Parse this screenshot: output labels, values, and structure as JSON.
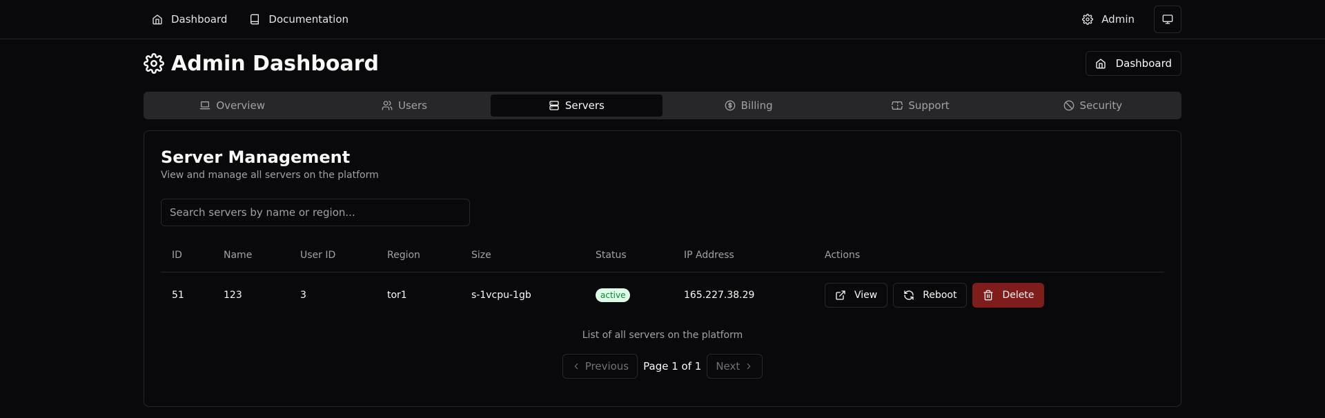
{
  "nav": {
    "dashboard": "Dashboard",
    "documentation": "Documentation",
    "admin": "Admin"
  },
  "header": {
    "title": "Admin Dashboard",
    "dashboard_button": "Dashboard"
  },
  "tabs": [
    {
      "label": "Overview",
      "icon": "laptop-icon"
    },
    {
      "label": "Users",
      "icon": "users-icon"
    },
    {
      "label": "Servers",
      "icon": "server-icon",
      "active": true
    },
    {
      "label": "Billing",
      "icon": "dollar-circle-icon"
    },
    {
      "label": "Support",
      "icon": "ticket-icon"
    },
    {
      "label": "Security",
      "icon": "ban-icon"
    }
  ],
  "card": {
    "title": "Server Management",
    "description": "View and manage all servers on the platform",
    "search_placeholder": "Search servers by name or region..."
  },
  "table": {
    "headers": [
      "ID",
      "Name",
      "User ID",
      "Region",
      "Size",
      "Status",
      "IP Address",
      "Actions"
    ],
    "rows": [
      {
        "id": "51",
        "name": "123",
        "user_id": "3",
        "region": "tor1",
        "size": "s-1vcpu-1gb",
        "status": "active",
        "ip": "165.227.38.29"
      }
    ],
    "caption": "List of all servers on the platform"
  },
  "actions": {
    "view": "View",
    "reboot": "Reboot",
    "delete": "Delete"
  },
  "pagination": {
    "previous": "Previous",
    "info": "Page 1 of 1",
    "next": "Next"
  },
  "colors": {
    "background": "#09090b",
    "border": "#27272a",
    "danger": "#7f1d1d",
    "badge_bg": "#dcfce7",
    "badge_text": "#15803d"
  }
}
